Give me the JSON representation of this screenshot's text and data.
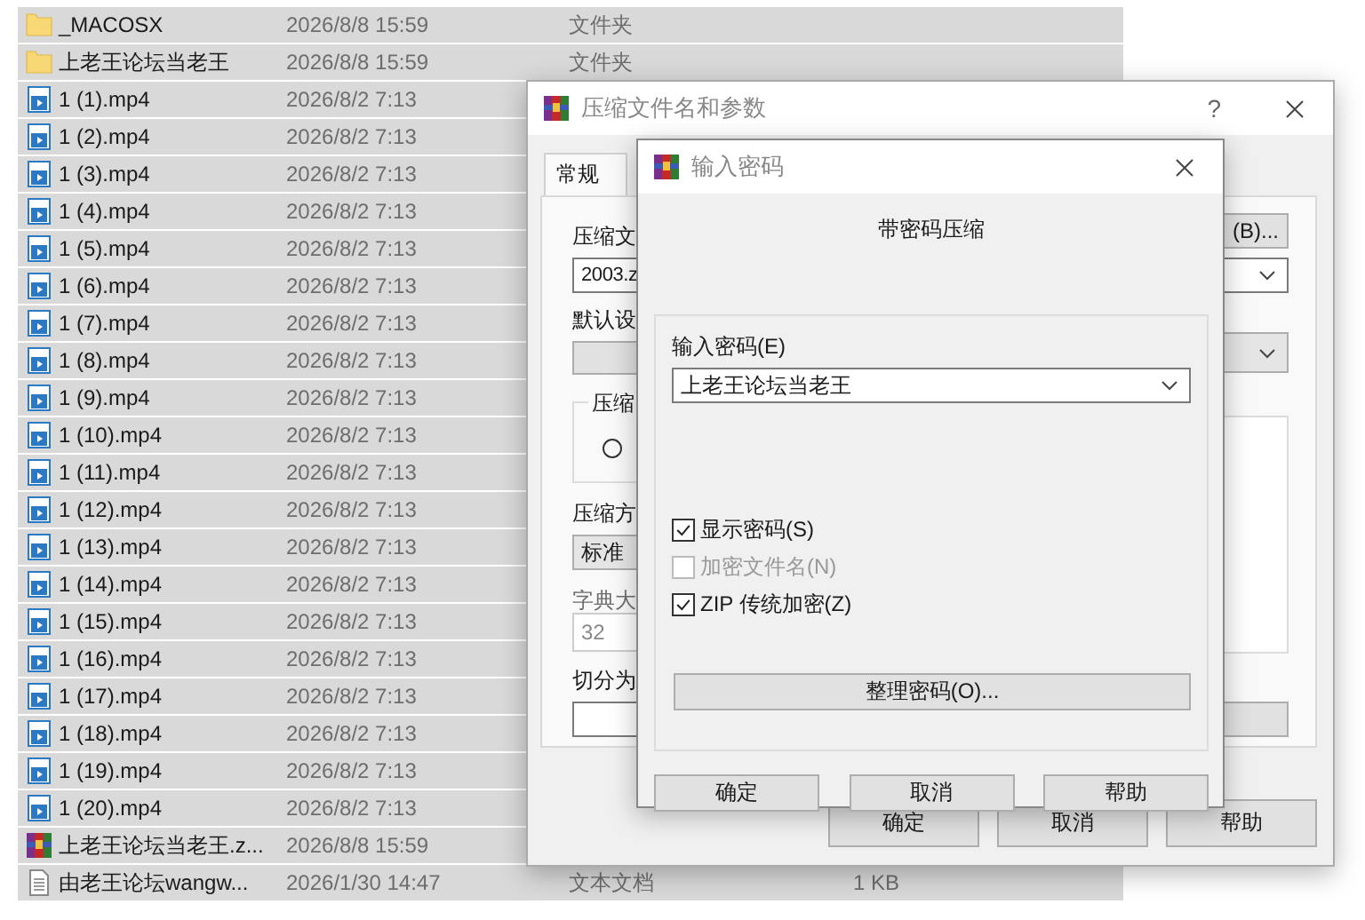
{
  "files": [
    {
      "kind": "folder",
      "name": "_MACOSX",
      "date": "2026/8/8 15:59",
      "type": "文件夹",
      "selected": true
    },
    {
      "kind": "folder",
      "name": "上老王论坛当老王",
      "date": "2026/8/8 15:59",
      "type": "文件夹",
      "selected": true
    },
    {
      "kind": "video",
      "name": "1 (1).mp4",
      "date": "2026/8/2 7:13",
      "selected": true
    },
    {
      "kind": "video",
      "name": "1 (2).mp4",
      "date": "2026/8/2 7:13",
      "selected": true
    },
    {
      "kind": "video",
      "name": "1 (3).mp4",
      "date": "2026/8/2 7:13",
      "selected": true
    },
    {
      "kind": "video",
      "name": "1 (4).mp4",
      "date": "2026/8/2 7:13",
      "selected": true
    },
    {
      "kind": "video",
      "name": "1 (5).mp4",
      "date": "2026/8/2 7:13",
      "selected": true
    },
    {
      "kind": "video",
      "name": "1 (6).mp4",
      "date": "2026/8/2 7:13",
      "selected": true
    },
    {
      "kind": "video",
      "name": "1 (7).mp4",
      "date": "2026/8/2 7:13",
      "selected": true
    },
    {
      "kind": "video",
      "name": "1 (8).mp4",
      "date": "2026/8/2 7:13",
      "selected": true
    },
    {
      "kind": "video",
      "name": "1 (9).mp4",
      "date": "2026/8/2 7:13",
      "selected": true
    },
    {
      "kind": "video",
      "name": "1 (10).mp4",
      "date": "2026/8/2 7:13",
      "selected": true
    },
    {
      "kind": "video",
      "name": "1 (11).mp4",
      "date": "2026/8/2 7:13",
      "selected": true
    },
    {
      "kind": "video",
      "name": "1 (12).mp4",
      "date": "2026/8/2 7:13",
      "selected": true
    },
    {
      "kind": "video",
      "name": "1 (13).mp4",
      "date": "2026/8/2 7:13",
      "selected": true
    },
    {
      "kind": "video",
      "name": "1 (14).mp4",
      "date": "2026/8/2 7:13",
      "selected": true
    },
    {
      "kind": "video",
      "name": "1 (15).mp4",
      "date": "2026/8/2 7:13",
      "selected": true
    },
    {
      "kind": "video",
      "name": "1 (16).mp4",
      "date": "2026/8/2 7:13",
      "selected": true
    },
    {
      "kind": "video",
      "name": "1 (17).mp4",
      "date": "2026/8/2 7:13",
      "selected": true
    },
    {
      "kind": "video",
      "name": "1 (18).mp4",
      "date": "2026/8/2 7:13",
      "selected": true
    },
    {
      "kind": "video",
      "name": "1 (19).mp4",
      "date": "2026/8/2 7:13",
      "selected": true
    },
    {
      "kind": "video",
      "name": "1 (20).mp4",
      "date": "2026/8/2 7:13",
      "selected": true
    },
    {
      "kind": "archive",
      "name": "上老王论坛当老王.z...",
      "date": "2026/8/8 15:59",
      "selected": true
    },
    {
      "kind": "text",
      "name": "由老王论坛wangw...",
      "date": "2026/1/30 14:47",
      "type": "文本文档",
      "size": "1 KB",
      "selected": true
    }
  ],
  "compress_dialog": {
    "title": "压缩文件名和参数",
    "help": "?",
    "tabs": [
      {
        "label": "常规",
        "selected": true
      }
    ],
    "archive_label": "压缩文",
    "browse_button": "(B)...",
    "archive_name": "2003.z",
    "profile_label": "默认设",
    "format_group": "压缩",
    "format_radio": {
      "selected": false
    },
    "method_label": "压缩方",
    "method_value": "标准",
    "dict_label": "字典大",
    "dict_value": "32",
    "split_label": "切分为",
    "buttons": [
      "确定",
      "取消",
      "帮助"
    ]
  },
  "password_dialog": {
    "title": "输入密码",
    "heading": "带密码压缩",
    "password_label": "输入密码(E)",
    "password_value": "上老王论坛当老王",
    "options": [
      {
        "label": "显示密码(S)",
        "checked": true,
        "disabled": false
      },
      {
        "label": "加密文件名(N)",
        "checked": false,
        "disabled": true
      },
      {
        "label": "ZIP 传统加密(Z)",
        "checked": true,
        "disabled": false
      }
    ],
    "organize_button": "整理密码(O)...",
    "buttons": [
      "确定",
      "取消",
      "帮助"
    ]
  }
}
